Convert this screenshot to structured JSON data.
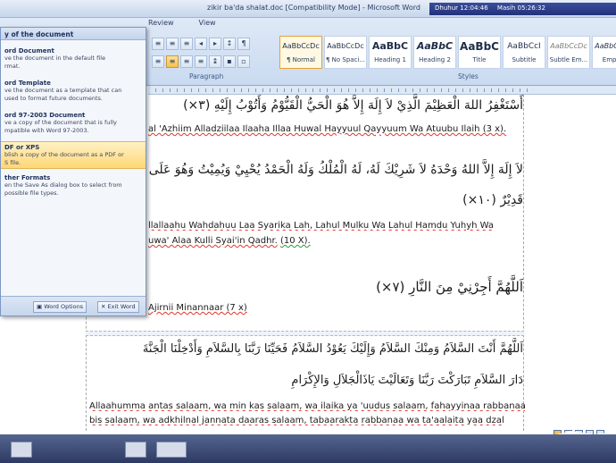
{
  "window": {
    "title": "zikir ba'da shalat.doc [Compatibility Mode] - Microsoft Word"
  },
  "clock": {
    "user": "Dhuhur 12:04:46",
    "next": "Masih 05:26:32"
  },
  "ribbon": {
    "tabs": [
      "Review",
      "View"
    ],
    "paragraph_label": "Paragraph",
    "styles_label": "Styles",
    "styles": [
      {
        "sample": "AaBbCcDc",
        "name": "¶ Normal"
      },
      {
        "sample": "AaBbCcDc",
        "name": "¶ No Spaci..."
      },
      {
        "sample": "AaBbC",
        "name": "Heading 1"
      },
      {
        "sample": "AaBbC",
        "name": "Heading 2"
      },
      {
        "sample": "AaBbC",
        "name": "Title"
      },
      {
        "sample": "AaBbCcI",
        "name": "Subtitle"
      },
      {
        "sample": "AaBbCcDc",
        "name": "Subtle Em..."
      },
      {
        "sample": "AaBbCcDc",
        "name": "Empha"
      }
    ]
  },
  "office_menu": {
    "header": "y of the document",
    "items": [
      {
        "title": "ord Document",
        "desc": [
          "ve the document in the default file",
          "rmat."
        ]
      },
      {
        "title": "ord Template",
        "desc": [
          "ve the document as a template that can",
          "used to format future documents."
        ]
      },
      {
        "title": "ord 97-2003 Document",
        "desc": [
          "ve a copy of the document that is fully",
          "mpatible with Word 97-2003."
        ]
      },
      {
        "title": "DF or XPS",
        "desc": [
          "blish a copy of the document as a PDF or",
          "S file."
        ]
      },
      {
        "title": "ther Formats",
        "desc": [
          "en the Save As dialog box to select from",
          "possible file types."
        ]
      }
    ],
    "word_options": "Word Options",
    "exit_word": "Exit Word"
  },
  "document": {
    "ar1": "أَسْتَغْفِرُ اللهَ الْعَظِيْمَ الَّذِيْ لاَ إِلَهَ إِلاَّ هُوَ الْحَيُّ الْقَيُّوْمُ وَأَتُوْبُ إِلَيْهِ (٣×)",
    "lat1": "al 'Azhiim Alladziilaa Ilaaha Illaa Huwal Hayyuul Qayyuum Wa Atuubu Ilaih (3 x).",
    "ar2a": "لاَ إِلَهَ إِلاَّ اللهُ وَحْدَهُ لاَ شَرِيْكَ لَهُ، لَهُ الْمُلْكُ وَلَهُ الْحَمْدُ يُحْيِيْ وَيُمِيْتُ وَهُوَ عَلَى",
    "ar2b": "قَدِيْرٌ (١٠×)",
    "lat2a": "llallaahu Wahdahuu Laa Syarika Lah, Lahul Mulku Wa Lahul Hamdu Yuhyh Wa",
    "lat2b": "uwa' Alaa Kulli Syai'in Qadhr.",
    "lat2c": "(10 X).",
    "ar3": "اَللَّهُمَّ أَجِرْنِيْ مِنَ النَّارِ (٧×)",
    "lat3": "Ajirnii Minannaar (7 x)",
    "ar4a": "اَللَّهُمَّ أَنْتَ السَّلاَمُ وَمِنْكَ السَّلاَمُ وَإِلَيْكَ يَعُوْدُ السَّلاَمُ فَحَيِّنَا رَبَّنَا بِالسَّلاَمِ وَأَدْخِلْنَا الْجَنَّةَ",
    "ar4b": "دَارَ السَّلاَمِ تَبَارَكْتَ رَبَّنَا وَتَعَالَيْتَ يَاذَالْجَلاَلِ وَالإِكْرَامِ",
    "lat4a": "Allaahumma antas salaam, wa min kas salaam, wa ilaika ya 'uudus salaam, fahayyinaa rabbanaa",
    "lat4b": "bis salaam, wa adkhilnal jannata daaras salaam, tabaarakta rabbanaa wa ta'aalaita yaa dzal"
  }
}
